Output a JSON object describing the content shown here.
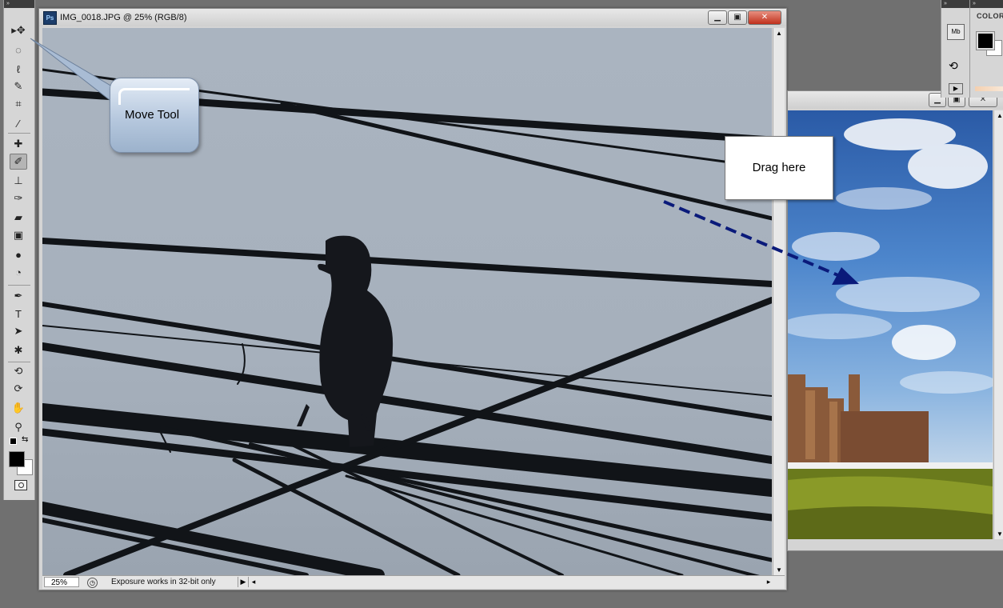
{
  "doc_window": {
    "app_icon": "Ps",
    "title": "IMG_0018.JPG @ 25% (RGB/8)",
    "zoom_value": "25%",
    "status_text": "Exposure works in 32-bit only"
  },
  "doc_window_2": {
    "title": ""
  },
  "color_panel": {
    "label": "COLOR"
  },
  "callouts": {
    "move_tool": "Move Tool",
    "drag_here": "Drag here"
  },
  "tools": [
    {
      "name": "move-tool-icon",
      "glyph": "▸✥"
    },
    {
      "name": "marquee-tool-icon",
      "glyph": "◌"
    },
    {
      "name": "lasso-tool-icon",
      "glyph": "ℓ"
    },
    {
      "name": "quick-selection-tool-icon",
      "glyph": "✎"
    },
    {
      "name": "crop-tool-icon",
      "glyph": "⌗"
    },
    {
      "name": "eyedropper-tool-icon",
      "glyph": "⁄"
    },
    {
      "name": "spot-healing-tool-icon",
      "glyph": "✚"
    },
    {
      "name": "brush-tool-icon",
      "glyph": "✐"
    },
    {
      "name": "clone-stamp-tool-icon",
      "glyph": "⊥"
    },
    {
      "name": "history-brush-tool-icon",
      "glyph": "✑"
    },
    {
      "name": "eraser-tool-icon",
      "glyph": "▰"
    },
    {
      "name": "gradient-tool-icon",
      "glyph": "▣"
    },
    {
      "name": "blur-tool-icon",
      "glyph": "●"
    },
    {
      "name": "dodge-tool-icon",
      "glyph": "◔"
    },
    {
      "name": "pen-tool-icon",
      "glyph": "✒"
    },
    {
      "name": "type-tool-icon",
      "glyph": "T"
    },
    {
      "name": "path-selection-tool-icon",
      "glyph": "➤"
    },
    {
      "name": "custom-shape-tool-icon",
      "glyph": "✱"
    },
    {
      "name": "3d-rotate-tool-icon",
      "glyph": "⟲"
    },
    {
      "name": "3d-orbit-tool-icon",
      "glyph": "⟳"
    },
    {
      "name": "hand-tool-icon",
      "glyph": "✋"
    },
    {
      "name": "zoom-tool-icon",
      "glyph": "⚲"
    }
  ],
  "colors": {
    "foreground": "#000000",
    "background": "#ffffff",
    "arrow": "#0a1a7a"
  }
}
